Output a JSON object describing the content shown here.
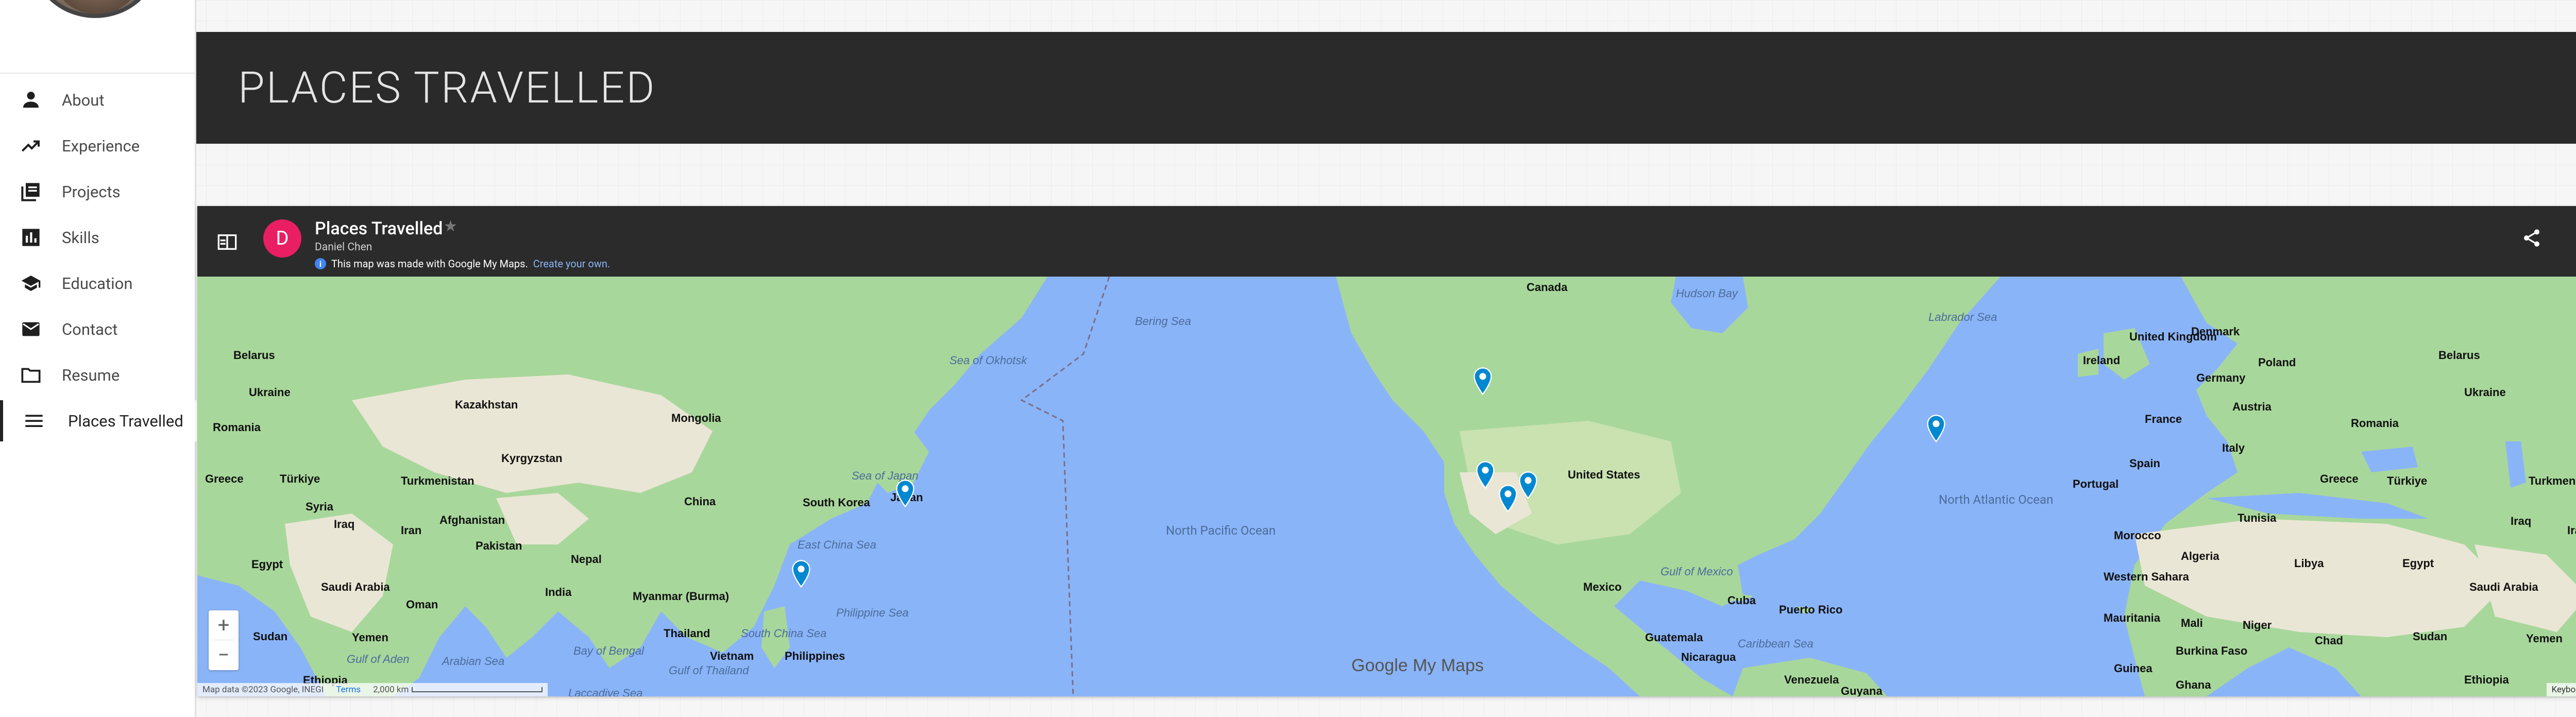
{
  "nav": {
    "items": [
      {
        "label": "About",
        "icon": "person-icon"
      },
      {
        "label": "Experience",
        "icon": "trending-up-icon"
      },
      {
        "label": "Projects",
        "icon": "library-books-icon"
      },
      {
        "label": "Skills",
        "icon": "bar-chart-icon"
      },
      {
        "label": "Education",
        "icon": "school-icon"
      },
      {
        "label": "Contact",
        "icon": "mail-icon"
      },
      {
        "label": "Resume",
        "icon": "folder-icon"
      },
      {
        "label": "Places Travelled",
        "icon": "menu-icon"
      }
    ],
    "active": "Places Travelled"
  },
  "banner": {
    "title": "PLACES TRAVELLED"
  },
  "map": {
    "title": "Places Travelled",
    "author": "Daniel Chen",
    "author_initial": "D",
    "made_with": "This map was made with Google My Maps.",
    "create_link": "Create your own.",
    "logo_text": "Google My Maps",
    "attribution": "Map data ©2023 Google, INEGI",
    "terms": "Terms",
    "scale": "2,000 km",
    "keyboard": "Keyboard shortcuts",
    "zoom_in": "+",
    "zoom_out": "−",
    "colors": {
      "land": "#a8d79b",
      "ocean": "#8ab4f8",
      "marker": "#0288d1",
      "header": "#2b2b2b",
      "author": "#e91e63"
    },
    "markers": [
      "Japan (Tokyo area)",
      "Taiwan",
      "Pacific Northwest",
      "California Bay Area",
      "Southern California",
      "Las Vegas area",
      "Toronto / New York area"
    ],
    "labels": {
      "countries": [
        "Belarus",
        "Ukraine",
        "Romania",
        "Greece",
        "Türkiye",
        "Kazakhstan",
        "Kyrgyzstan",
        "Turkmenistan",
        "Afghanistan",
        "Pakistan",
        "Iran",
        "Iraq",
        "Syria",
        "Egypt",
        "Saudi Arabia",
        "Oman",
        "Yemen",
        "Sudan",
        "Ethiopia",
        "India",
        "Nepal",
        "Myanmar (Burma)",
        "Thailand",
        "Vietnam",
        "Philippines",
        "China",
        "Mongolia",
        "South Korea",
        "Japan",
        "Canada",
        "United States",
        "Mexico",
        "Cuba",
        "Puerto Rico",
        "Guatemala",
        "Nicaragua",
        "Venezuela",
        "Guyana",
        "Ireland",
        "United Kingdom",
        "Denmark",
        "Poland",
        "Germany",
        "Austria",
        "France",
        "Spain",
        "Portugal",
        "Italy",
        "Morocco",
        "Algeria",
        "Tunisia",
        "Libya",
        "Western Sahara",
        "Mauritania",
        "Mali",
        "Niger",
        "Chad",
        "Burkina Faso",
        "Guinea",
        "Ghana"
      ],
      "water": [
        "Sea of Okhotsk",
        "Bering Sea",
        "Hudson Bay",
        "Labrador Sea",
        "Sea of Japan",
        "East China Sea",
        "Philippine Sea",
        "South China Sea",
        "Bay of Bengal",
        "Arabian Sea",
        "Gulf of Aden",
        "Gulf of Thailand",
        "Gulf of Mexico",
        "Caribbean Sea",
        "Laccadive Sea"
      ],
      "oceans": [
        "North Pacific Ocean",
        "North Atlantic Ocean"
      ]
    }
  }
}
